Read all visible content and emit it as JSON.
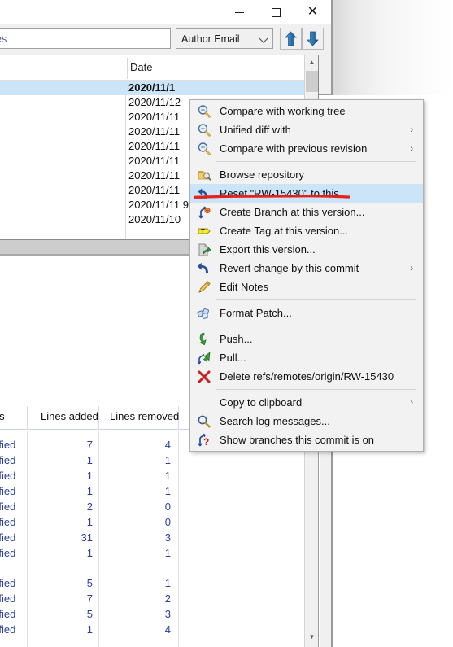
{
  "window": {
    "controls": [
      {
        "name": "minimize",
        "label": "–"
      },
      {
        "name": "maximize",
        "label": "□"
      },
      {
        "name": "close",
        "label": "✕"
      }
    ]
  },
  "toolbar": {
    "filter_value": "es",
    "filter_placeholder": "",
    "search_field_selected": "Author Email",
    "search_field_options": [
      "Author Email"
    ],
    "up_button_tooltip": "Find previous",
    "down_button_tooltip": "Find next"
  },
  "commit_list": {
    "columns": [
      "",
      "Date"
    ],
    "rows": [
      {
        "date": "2020/11/1",
        "selected": true
      },
      {
        "date": "2020/11/12",
        "selected": false
      },
      {
        "date": "2020/11/11",
        "selected": false
      },
      {
        "date": "2020/11/11",
        "selected": false
      },
      {
        "date": "2020/11/11",
        "selected": false
      },
      {
        "date": "2020/11/11",
        "selected": false
      },
      {
        "date": "2020/11/11",
        "selected": false
      },
      {
        "date": "2020/11/11",
        "selected": false
      },
      {
        "date": "2020/11/11 9",
        "selected": false
      },
      {
        "date": "2020/11/10",
        "selected": false
      }
    ]
  },
  "stats_table": {
    "columns": [
      "atus",
      "Lines added",
      "Lines removed"
    ],
    "groups": [
      {
        "rows": [
          {
            "status": "odified",
            "added": "7",
            "removed": "4"
          },
          {
            "status": "odified",
            "added": "1",
            "removed": "1"
          },
          {
            "status": "odified",
            "added": "1",
            "removed": "1"
          },
          {
            "status": "odified",
            "added": "1",
            "removed": "1"
          },
          {
            "status": "odified",
            "added": "2",
            "removed": "0"
          },
          {
            "status": "odified",
            "added": "1",
            "removed": "0"
          },
          {
            "status": "odified",
            "added": "31",
            "removed": "3"
          },
          {
            "status": "odified",
            "added": "1",
            "removed": "1"
          }
        ]
      },
      {
        "rows": [
          {
            "status": "odified",
            "added": "5",
            "removed": "1"
          },
          {
            "status": "odified",
            "added": "7",
            "removed": "2"
          },
          {
            "status": "odified",
            "added": "5",
            "removed": "3"
          },
          {
            "status": "odified",
            "added": "1",
            "removed": "4"
          }
        ]
      }
    ]
  },
  "context_menu": {
    "items": [
      {
        "label": "Compare with working tree",
        "icon": "magnifier-compare-icon",
        "submenu": false,
        "highlighted": false,
        "separator_after": false
      },
      {
        "label": "Unified diff with",
        "icon": "magnifier-compare-icon",
        "submenu": true,
        "highlighted": false,
        "separator_after": false
      },
      {
        "label": "Compare with previous revision",
        "icon": "magnifier-compare-icon",
        "submenu": true,
        "highlighted": false,
        "separator_after": true
      },
      {
        "label": "Browse repository",
        "icon": "folder-browse-icon",
        "submenu": false,
        "highlighted": false,
        "separator_after": false
      },
      {
        "label": "Reset \"RW-15430\" to this...",
        "icon": "reset-arrow-icon",
        "submenu": false,
        "highlighted": true,
        "separator_after": false
      },
      {
        "label": "Create Branch at this version...",
        "icon": "branch-icon",
        "submenu": false,
        "highlighted": false,
        "separator_after": false
      },
      {
        "label": "Create Tag at this version...",
        "icon": "tag-icon",
        "submenu": false,
        "highlighted": false,
        "separator_after": false
      },
      {
        "label": "Export this version...",
        "icon": "export-icon",
        "submenu": false,
        "highlighted": false,
        "separator_after": false
      },
      {
        "label": "Revert change by this commit",
        "icon": "revert-arrow-icon",
        "submenu": true,
        "highlighted": false,
        "separator_after": false
      },
      {
        "label": "Edit Notes",
        "icon": "pencil-icon",
        "submenu": false,
        "highlighted": false,
        "separator_after": true
      },
      {
        "label": "Format Patch...",
        "icon": "patch-icon",
        "submenu": false,
        "highlighted": false,
        "separator_after": true
      },
      {
        "label": "Push...",
        "icon": "push-arrow-icon",
        "submenu": false,
        "highlighted": false,
        "separator_after": false
      },
      {
        "label": "Pull...",
        "icon": "pull-arrow-icon",
        "submenu": false,
        "highlighted": false,
        "separator_after": false
      },
      {
        "label": "Delete refs/remotes/origin/RW-15430",
        "icon": "delete-x-icon",
        "submenu": false,
        "highlighted": false,
        "separator_after": true
      },
      {
        "label": "Copy to clipboard",
        "icon": "none",
        "submenu": true,
        "highlighted": false,
        "separator_after": false
      },
      {
        "label": "Search log messages...",
        "icon": "magnifier-icon",
        "submenu": false,
        "highlighted": false,
        "separator_after": false
      },
      {
        "label": "Show branches this commit is on",
        "icon": "branch-question-icon",
        "submenu": false,
        "highlighted": false,
        "separator_after": false
      }
    ]
  },
  "annotation": {
    "red_underline_color": "#e8211a",
    "target": "Reset \"RW-15430\" to this..."
  },
  "colors": {
    "highlight": "#cce4f7",
    "menu_bg": "#f2f2f2",
    "table_text": "#2b3fa0",
    "window_chrome": "#f0f0f0"
  }
}
